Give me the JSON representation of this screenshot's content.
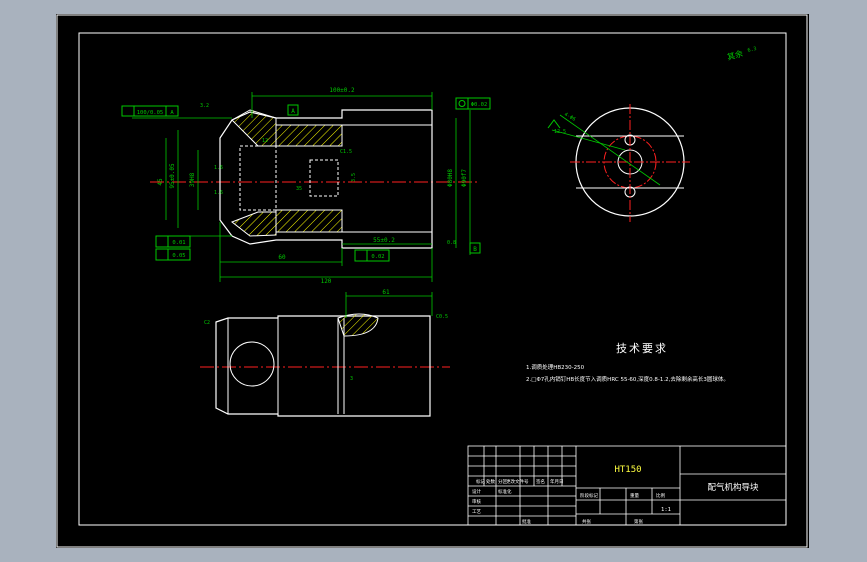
{
  "colors": {
    "background_outer": "#a9b2be",
    "sheet": "#000000",
    "outline": "#ffffff",
    "dimension": "#00c800",
    "centerline": "#ff2020",
    "hatch": "#ffff00",
    "text_white": "#ffffff",
    "text_yellow": "#ffff40"
  },
  "dims_main": {
    "top_len": "100±0.2",
    "bot_len1": "60",
    "bot_len2": "120",
    "bot_len3": "55±0.2",
    "left_dia1": "45",
    "left_dia2": "95±0.05",
    "left_dia3": "39H8",
    "right_dia1": "Φ80H8",
    "right_dia2": "Φ90f7",
    "tol_parallel": "100/0.05",
    "tol_box_a": "A",
    "tol_box_b": "B",
    "pos_small": "Φ0.02",
    "flat_1": "0.01",
    "flat_2": "0.05",
    "flat_3": "0.02",
    "rough_1": "1.6",
    "rough_2": "1.6",
    "rough_3": "0.8",
    "rough_4": "3.2",
    "slot_width": "3.5",
    "chamfer_note": "C1.5",
    "ref_a": "A",
    "label_35": "35",
    "label_12": "12"
  },
  "dims_side": {
    "angle": "4-Φ6",
    "rough": "12.5"
  },
  "dims_front": {
    "top_len": "61",
    "chamfer_left": "C2",
    "chamfer_right": "C0.5",
    "slot": "3"
  },
  "corner_note": "其余",
  "corner_rough": "6.3",
  "tech": {
    "title": "技术要求",
    "line1": "1.调质处理HB230-250",
    "line2": "2.□Φ7孔内销钉HB长度节入调质HRC 55-60,深度0.8-1.2,去除剩余高长3圆球体。"
  },
  "title_block": {
    "material": "HT150",
    "part_name": "配气机构导块",
    "scale": "1:1",
    "row_labels": [
      "标记",
      "处数",
      "分区",
      "更改文件号",
      "签名",
      "年月日"
    ],
    "labels_left": [
      "设计",
      "标准化",
      "审核",
      "工艺",
      "批准"
    ],
    "labels_mid": [
      "阶段标记",
      "重量",
      "比例",
      "共张",
      "第张"
    ]
  }
}
